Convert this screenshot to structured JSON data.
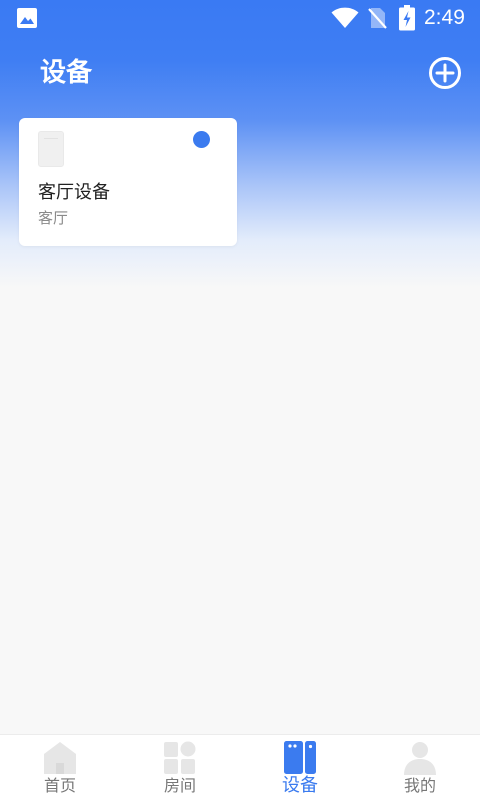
{
  "status_bar": {
    "time": "2:49",
    "icons": [
      "gallery-icon",
      "wifi-icon",
      "no-sim-icon",
      "battery-charging-icon"
    ]
  },
  "header": {
    "title": "设备",
    "add_icon": "add-circle-icon"
  },
  "devices": [
    {
      "name": "客厅设备",
      "room": "客厅",
      "online": true,
      "status_color": "#3b7bef"
    }
  ],
  "tab_bar": {
    "active_index": 2,
    "active_color": "#3b7bef",
    "tabs": [
      {
        "label": "首页",
        "icon": "home-icon"
      },
      {
        "label": "房间",
        "icon": "rooms-icon"
      },
      {
        "label": "设备",
        "icon": "devices-icon"
      },
      {
        "label": "我的",
        "icon": "profile-icon"
      }
    ]
  },
  "colors": {
    "brand": "#3a7af3",
    "background": "#f8f8f8",
    "inactive_icon": "#e6e6e6"
  }
}
